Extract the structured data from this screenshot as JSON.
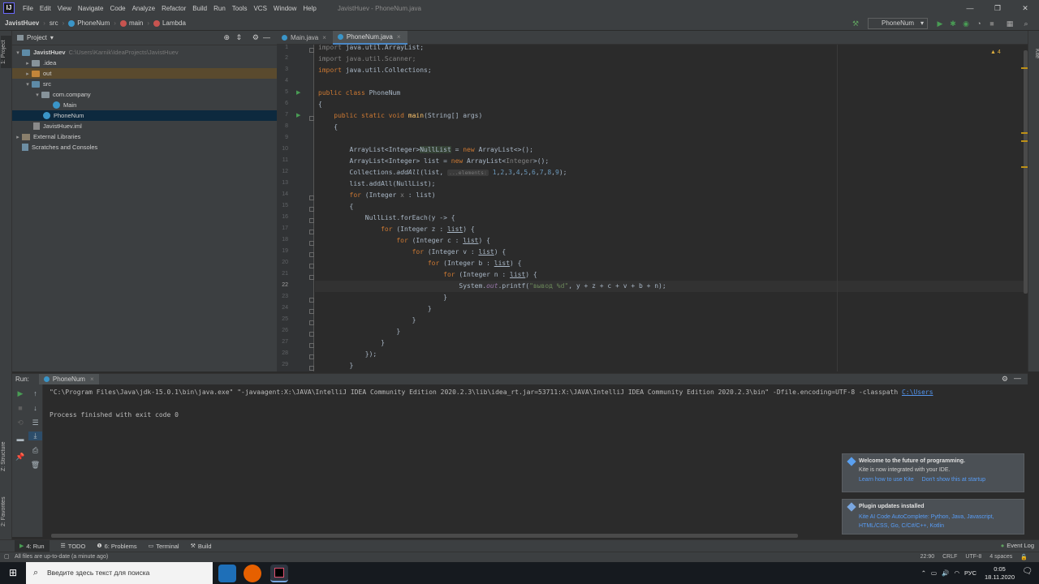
{
  "menubar": {
    "logo": "IJ",
    "items": [
      "File",
      "Edit",
      "View",
      "Navigate",
      "Code",
      "Analyze",
      "Refactor",
      "Build",
      "Run",
      "Tools",
      "VCS",
      "Window",
      "Help"
    ],
    "window_title": "JavistHuev - PhoneNum.java"
  },
  "navbar": {
    "crumbs": [
      "JavistHuev",
      "src",
      "PhoneNum",
      "main",
      "Lambda"
    ],
    "run_config": "PhoneNum"
  },
  "left_stripe": {
    "project": "1: Project",
    "structure": "Z: Structure",
    "favorites": "2: Favorites"
  },
  "project": {
    "header": "Project",
    "tree": [
      {
        "label": "JavistHuev",
        "extra": "C:\\Users\\Karnik\\IdeaProjects\\JavistHuev",
        "icon": "folder-icon",
        "arrow": "▾"
      },
      {
        "label": ".idea",
        "extra": "",
        "icon": "folder-icon",
        "arrow": "▸"
      },
      {
        "label": "out",
        "extra": "",
        "icon": "folder-icon",
        "arrow": "▸"
      },
      {
        "label": "src",
        "extra": "",
        "icon": "folder-icon",
        "arrow": "▾"
      },
      {
        "label": "com.company",
        "extra": "",
        "icon": "package-icon",
        "arrow": "▾"
      },
      {
        "label": "Main",
        "extra": "",
        "icon": "class-icon",
        "arrow": ""
      },
      {
        "label": "PhoneNum",
        "extra": "",
        "icon": "class-icon",
        "arrow": ""
      },
      {
        "label": "JavistHuev.iml",
        "extra": "",
        "icon": "file-icon",
        "arrow": ""
      },
      {
        "label": "External Libraries",
        "extra": "",
        "icon": "library-icon",
        "arrow": "▸"
      },
      {
        "label": "Scratches and Consoles",
        "extra": "",
        "icon": "scratch-icon",
        "arrow": ""
      }
    ]
  },
  "editor": {
    "tabs": [
      "Main.java",
      "PhoneNum.java"
    ],
    "warnings": "▲ 4",
    "line_numbers": [
      "1",
      "2",
      "3",
      "4",
      "5",
      "6",
      "7",
      "8",
      "9",
      "10",
      "11",
      "12",
      "13",
      "14",
      "15",
      "16",
      "17",
      "18",
      "19",
      "20",
      "21",
      "22",
      "23",
      "24",
      "25",
      "26",
      "27",
      "28",
      "29"
    ],
    "current_line": "22"
  },
  "run_panel": {
    "label": "Run:",
    "tab": "PhoneNum",
    "command": "\"C:\\Program Files\\Java\\jdk-15.0.1\\bin\\java.exe\" \"-javaagent:X:\\JAVA\\IntelliJ IDEA Community Edition 2020.2.3\\lib\\idea_rt.jar=53711:X:\\JAVA\\IntelliJ IDEA Community Edition 2020.2.3\\bin\" -Dfile.encoding=UTF-8 -classpath ",
    "command_link": "C:\\Users",
    "exit": "Process finished with exit code 0"
  },
  "notifications": [
    {
      "title": "Welcome to the future of programming.",
      "text": "Kite is now integrated with your IDE.",
      "links": [
        "Learn how to use Kite",
        "Don't show this at startup"
      ]
    },
    {
      "title": "Plugin updates installed",
      "text": "",
      "links": [
        "Kite AI Code AutoComplete: Python, Java, Javascript, HTML/CSS, Go, C/C#/C++, Kotlin"
      ]
    }
  ],
  "toolwindows": {
    "run": "4: Run",
    "todo": "TODO",
    "problems": "6: Problems",
    "terminal": "Terminal",
    "build": "Build",
    "event_log": "Event Log"
  },
  "status": {
    "message": "All files are up-to-date (a minute ago)",
    "position": "22:90",
    "line_sep": "CRLF",
    "encoding": "UTF-8",
    "indent": "4 spaces"
  },
  "taskbar": {
    "search_placeholder": "Введите здесь текст для поиска",
    "lang": "РУС",
    "time": "0:05",
    "date": "18.11.2020"
  },
  "colors": {
    "accent": "#4a88c7",
    "run_green": "#499c54",
    "keyword": "#cc7832",
    "string": "#6a8759",
    "number": "#6897bb",
    "link": "#589df6"
  }
}
